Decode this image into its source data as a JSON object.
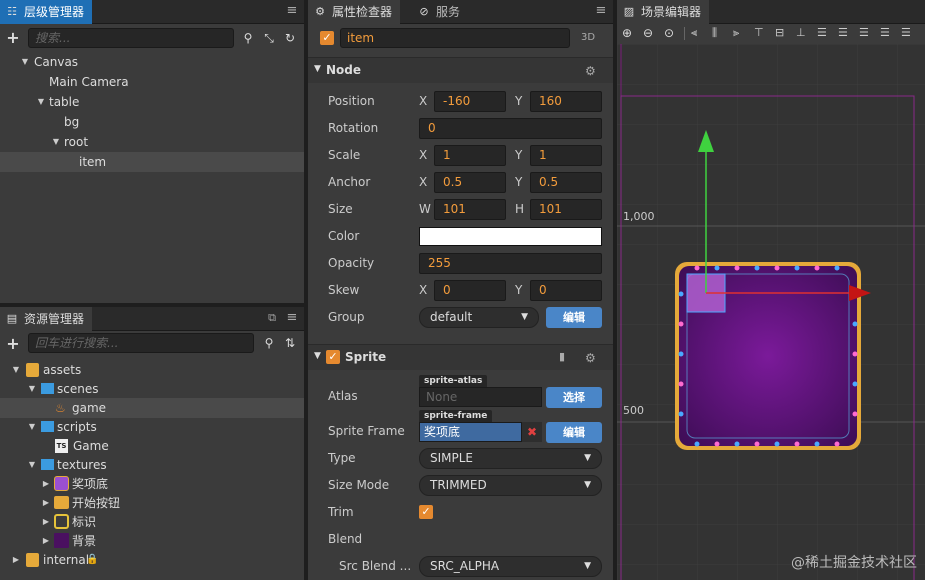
{
  "hierarchy": {
    "tab": "层级管理器",
    "search_placeholder": "搜索...",
    "nodes": [
      {
        "label": "Canvas",
        "arrow": "▼"
      },
      {
        "label": "Main Camera",
        "arrow": ""
      },
      {
        "label": "table",
        "arrow": "▼"
      },
      {
        "label": "bg",
        "arrow": ""
      },
      {
        "label": "root",
        "arrow": "▼"
      },
      {
        "label": "item",
        "arrow": ""
      }
    ]
  },
  "assets": {
    "tab": "资源管理器",
    "search_placeholder": "回车进行搜索...",
    "nodes": [
      {
        "label": "assets",
        "arrow": "▼"
      },
      {
        "label": "scenes",
        "arrow": "▼"
      },
      {
        "label": "game",
        "arrow": ""
      },
      {
        "label": "scripts",
        "arrow": "▼"
      },
      {
        "label": "Game",
        "arrow": "",
        "badge": "TS"
      },
      {
        "label": "textures",
        "arrow": "▼"
      },
      {
        "label": "奖项底",
        "arrow": "▶"
      },
      {
        "label": "开始按钮",
        "arrow": "▶"
      },
      {
        "label": "标识",
        "arrow": "▶"
      },
      {
        "label": "背景",
        "arrow": "▶"
      },
      {
        "label": "internal",
        "arrow": "▶"
      }
    ]
  },
  "inspector": {
    "tab": "属性检查器",
    "tab2": "服务",
    "node_name": "item",
    "mode_label": "3D",
    "node_section": "Node",
    "position": {
      "label": "Position",
      "xl": "X",
      "x": "-160",
      "yl": "Y",
      "y": "160"
    },
    "rotation": {
      "label": "Rotation",
      "value": "0"
    },
    "scale": {
      "label": "Scale",
      "xl": "X",
      "x": "1",
      "yl": "Y",
      "y": "1"
    },
    "anchor": {
      "label": "Anchor",
      "xl": "X",
      "x": "0.5",
      "yl": "Y",
      "y": "0.5"
    },
    "size": {
      "label": "Size",
      "wl": "W",
      "w": "101",
      "hl": "H",
      "h": "101"
    },
    "color": {
      "label": "Color",
      "value": "#ffffff"
    },
    "opacity": {
      "label": "Opacity",
      "value": "255"
    },
    "skew": {
      "label": "Skew",
      "xl": "X",
      "x": "0",
      "yl": "Y",
      "y": "0"
    },
    "group": {
      "label": "Group",
      "value": "default",
      "edit": "编辑"
    },
    "sprite_section": "Sprite",
    "atlas": {
      "label": "Atlas",
      "tag": "sprite-atlas",
      "value": "None",
      "btn": "选择"
    },
    "sprite_frame": {
      "label": "Sprite Frame",
      "tag": "sprite-frame",
      "value": "奖项底",
      "btn": "编辑"
    },
    "type": {
      "label": "Type",
      "value": "SIMPLE"
    },
    "size_mode": {
      "label": "Size Mode",
      "value": "TRIMMED"
    },
    "trim": {
      "label": "Trim"
    },
    "blend": {
      "label": "Blend"
    },
    "src_blend": {
      "label": "Src Blend ...",
      "value": "SRC_ALPHA"
    }
  },
  "scene": {
    "tab": "场景编辑器",
    "ruler_top": "1,000",
    "ruler_mid": "500",
    "watermark": "@稀土掘金技术社区"
  },
  "colors": {
    "accent": "#e5892f",
    "blue": "#4a86c8",
    "tab_blue": "#1f6fb5"
  }
}
